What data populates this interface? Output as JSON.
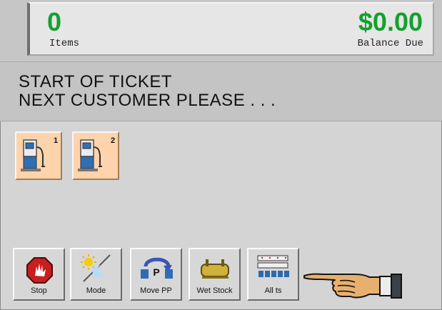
{
  "header": {
    "items_count": "0",
    "items_label": "Items",
    "balance_due": "$0.00",
    "balance_label": "Balance Due",
    "accent_color": "#12a12c"
  },
  "message": {
    "line1": "START OF TICKET",
    "line2": "NEXT CUSTOMER PLEASE . . ."
  },
  "pumps": [
    {
      "number": "1",
      "icon": "fuel-pump-icon",
      "color": "#ffd3ab"
    },
    {
      "number": "2",
      "icon": "fuel-pump-icon",
      "color": "#ffd3ab"
    }
  ],
  "toolbar": [
    {
      "label": "Stop",
      "icon": "stop-icon"
    },
    {
      "label": "Mode",
      "icon": "day-night-mode-icon"
    },
    {
      "label": "Move PP",
      "icon": "move-prepay-icon"
    },
    {
      "label": "Wet Stock",
      "icon": "fuel-tank-icon"
    },
    {
      "label": "All ts",
      "icon": "all-pumps-icon"
    }
  ],
  "pointer_icon": "pointing-hand-icon"
}
